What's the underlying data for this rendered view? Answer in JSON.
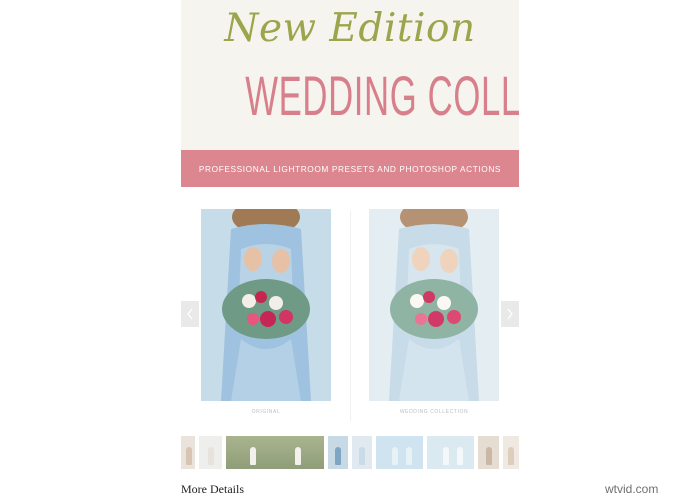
{
  "banner": {
    "script_title": "New Edition",
    "main_title": "WEDDING COLLECTION",
    "subtitle_bar": "PROFESSIONAL LIGHTROOM PRESETS AND PHOTOSHOP ACTIONS"
  },
  "gallery": {
    "left_caption": "ORIGINAL",
    "right_caption": "WEDDING COLLECTION",
    "prev_icon": "chevron-left-icon",
    "next_icon": "chevron-right-icon"
  },
  "thumbnails": [
    {
      "id": "thumb-1",
      "width_share": "narrow"
    },
    {
      "id": "thumb-2",
      "width_share": "wide"
    },
    {
      "id": "thumb-3",
      "width_share": "narrow"
    },
    {
      "id": "thumb-4",
      "width_share": "narrow"
    },
    {
      "id": "thumb-5",
      "width_share": "medium"
    },
    {
      "id": "thumb-6",
      "width_share": "medium"
    },
    {
      "id": "thumb-7",
      "width_share": "narrow"
    },
    {
      "id": "thumb-8",
      "width_share": "narrow"
    }
  ],
  "details": {
    "heading": "More Details"
  },
  "watermark": {
    "text": "wtvid.com"
  },
  "colors": {
    "banner_bg": "#f6f4ef",
    "script_green": "#9aa54c",
    "title_pink": "#d7808b",
    "bar_pink": "#dc8690"
  }
}
